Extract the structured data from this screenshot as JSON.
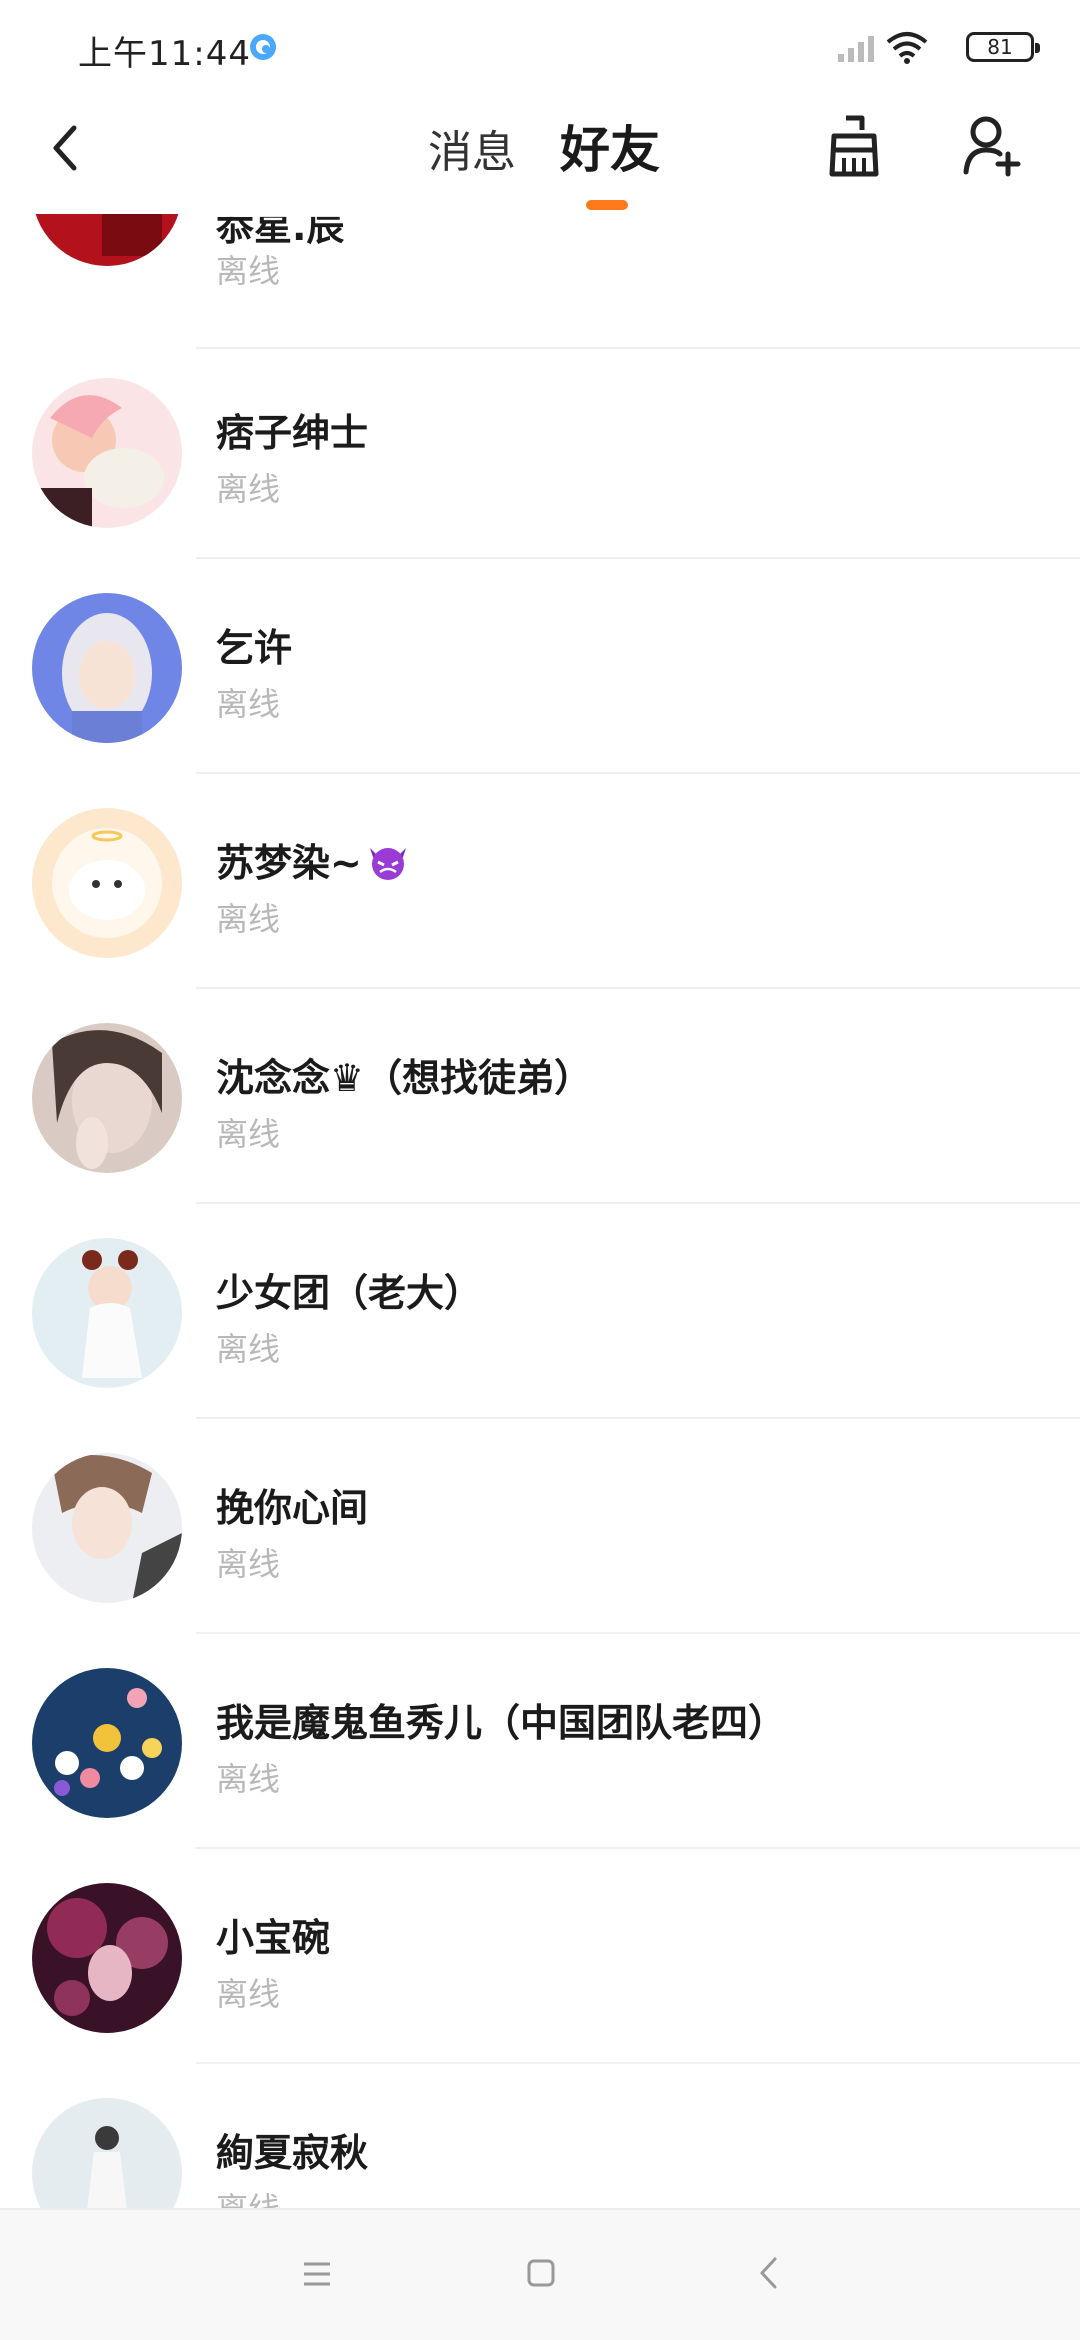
{
  "status_bar": {
    "time": "上午11:44",
    "battery": "81"
  },
  "header": {
    "tabs": [
      {
        "label": "消息",
        "active": false
      },
      {
        "label": "好友",
        "active": true
      }
    ],
    "accent_color": "#ff7a1a"
  },
  "friends": [
    {
      "name": "忝星.辰",
      "status": "离线"
    },
    {
      "name": "痞子绅士",
      "status": "离线"
    },
    {
      "name": "乞许",
      "status": "离线"
    },
    {
      "name": "苏梦染~",
      "status": "离线",
      "emoji": "devil-emoji"
    },
    {
      "name": "沈念念♛（想找徒弟）",
      "status": "离线"
    },
    {
      "name": "少女团（老大）",
      "status": "离线"
    },
    {
      "name": "挽你心间",
      "status": "离线"
    },
    {
      "name": "我是魔鬼鱼秀儿（中国团队老四）",
      "status": "离线"
    },
    {
      "name": "小宝碗",
      "status": "离线"
    },
    {
      "name": "絢夏寂秋",
      "status": "离线"
    }
  ],
  "icons": {
    "back": "back-arrow-icon",
    "clean": "broom-clean-icon",
    "add_friend": "add-friend-icon",
    "nav_menu": "menu-icon",
    "nav_home": "home-icon",
    "nav_back": "nav-back-icon"
  }
}
